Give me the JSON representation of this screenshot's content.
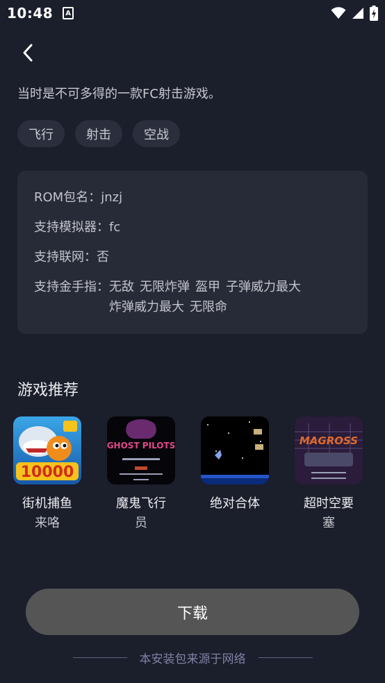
{
  "status_bar": {
    "time": "10:48",
    "app_icon_letter": "A"
  },
  "header": {
    "back_icon": "chevron-left-icon"
  },
  "description": "当时是不可多得的一款FC射击游戏。",
  "tags": [
    "飞行",
    "射击",
    "空战"
  ],
  "info": {
    "rom_label": "ROM包名：",
    "rom_value": "jnzj",
    "emulator_label": "支持模拟器：",
    "emulator_value": "fc",
    "network_label": "支持联网：",
    "network_value": "否",
    "cheat_label": "支持金手指：",
    "cheats": [
      "无敌",
      "无限炸弹",
      "盔甲",
      "子弹威力最大",
      "炸弹威力最大",
      "无限命"
    ]
  },
  "recommend": {
    "title": "游戏推荐",
    "games": [
      {
        "name_line1": "街机捕鱼",
        "name_line2": "来咯",
        "cover_text": "10000"
      },
      {
        "name_line1": "魔鬼飞行",
        "name_line2": "员",
        "cover_text": "GHOST PILOTS"
      },
      {
        "name_line1": "绝对合体",
        "name_line2": "",
        "cover_text": ""
      },
      {
        "name_line1": "超时空要",
        "name_line2": "塞",
        "cover_text": "MAGROSS"
      }
    ]
  },
  "download_label": "下载",
  "footer_text": "本安装包来源于网络",
  "colors": {
    "background": "#1b1e2b",
    "card": "#272b38",
    "button": "#555555",
    "footer_text": "#7e82a3"
  }
}
